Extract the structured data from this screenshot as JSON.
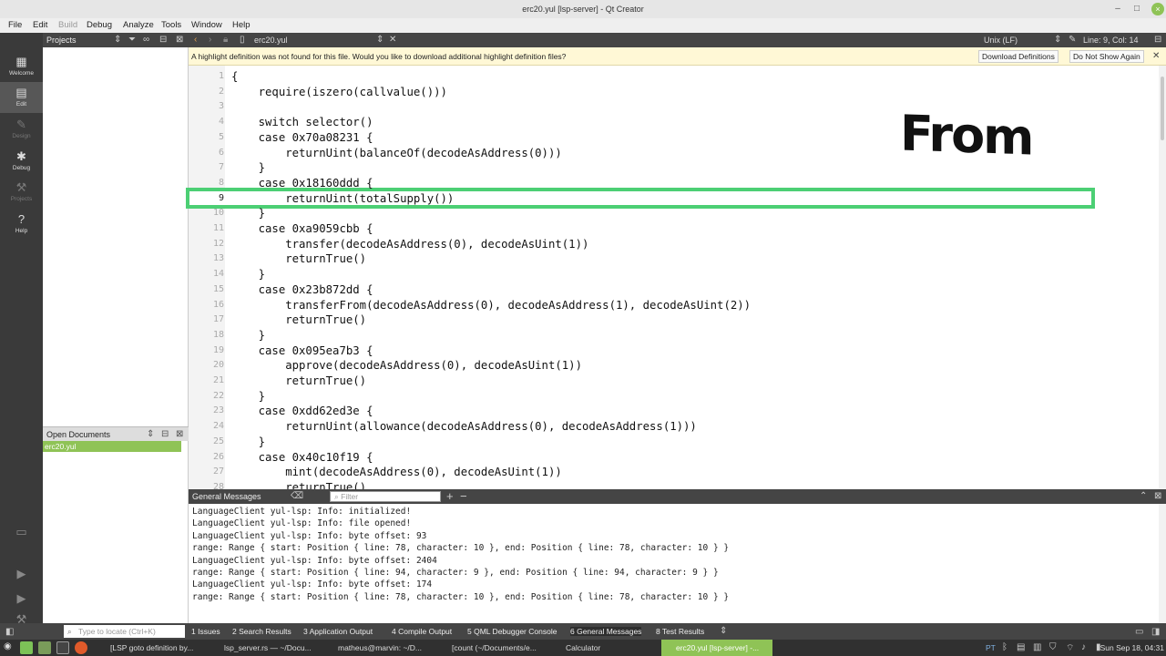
{
  "window": {
    "title": "erc20.yul [lsp-server] - Qt Creator"
  },
  "menu": [
    "File",
    "Edit",
    "Build",
    "Debug",
    "Analyze",
    "Tools",
    "Window",
    "Help"
  ],
  "modes": [
    {
      "label": "Welcome",
      "icon": "grid-icon"
    },
    {
      "label": "Edit",
      "icon": "edit-icon"
    },
    {
      "label": "Design",
      "icon": "pencil-icon"
    },
    {
      "label": "Debug",
      "icon": "bug-icon"
    },
    {
      "label": "Projects",
      "icon": "wrench-icon"
    },
    {
      "label": "Help",
      "icon": "help-icon"
    }
  ],
  "projects_panel": {
    "title": "Projects"
  },
  "open_documents": {
    "title": "Open Documents",
    "items": [
      "erc20.yul"
    ]
  },
  "editor": {
    "file": "erc20.yul",
    "line_ending": "Unix (LF)",
    "position": "Line: 9, Col: 14",
    "current_line": "9",
    "infobar": {
      "text": "A highlight definition was not found for this file. Would you like to download additional highlight definition files?",
      "download_label": "Download Definitions",
      "dont_show_label": "Do Not Show Again"
    },
    "lines": [
      {
        "n": "1",
        "code": "{"
      },
      {
        "n": "2",
        "code": "    require(iszero(callvalue()))"
      },
      {
        "n": "3",
        "code": ""
      },
      {
        "n": "4",
        "code": "    switch selector()"
      },
      {
        "n": "5",
        "code": "    case 0x70a08231 {"
      },
      {
        "n": "6",
        "code": "        returnUint(balanceOf(decodeAsAddress(0)))"
      },
      {
        "n": "7",
        "code": "    }"
      },
      {
        "n": "8",
        "code": "    case 0x18160ddd {"
      },
      {
        "n": "9",
        "code": "        returnUint(totalSupply())"
      },
      {
        "n": "10",
        "code": "    }"
      },
      {
        "n": "11",
        "code": "    case 0xa9059cbb {"
      },
      {
        "n": "12",
        "code": "        transfer(decodeAsAddress(0), decodeAsUint(1))"
      },
      {
        "n": "13",
        "code": "        returnTrue()"
      },
      {
        "n": "14",
        "code": "    }"
      },
      {
        "n": "15",
        "code": "    case 0x23b872dd {"
      },
      {
        "n": "16",
        "code": "        transferFrom(decodeAsAddress(0), decodeAsAddress(1), decodeAsUint(2))"
      },
      {
        "n": "17",
        "code": "        returnTrue()"
      },
      {
        "n": "18",
        "code": "    }"
      },
      {
        "n": "19",
        "code": "    case 0x095ea7b3 {"
      },
      {
        "n": "20",
        "code": "        approve(decodeAsAddress(0), decodeAsUint(1))"
      },
      {
        "n": "21",
        "code": "        returnTrue()"
      },
      {
        "n": "22",
        "code": "    }"
      },
      {
        "n": "23",
        "code": "    case 0xdd62ed3e {"
      },
      {
        "n": "24",
        "code": "        returnUint(allowance(decodeAsAddress(0), decodeAsAddress(1)))"
      },
      {
        "n": "25",
        "code": "    }"
      },
      {
        "n": "26",
        "code": "    case 0x40c10f19 {"
      },
      {
        "n": "27",
        "code": "        mint(decodeAsAddress(0), decodeAsUint(1))"
      },
      {
        "n": "28",
        "code": "        returnTrue()"
      }
    ],
    "overlay_text": "From"
  },
  "output": {
    "title": "General Messages",
    "filter_placeholder": "Filter",
    "lines": [
      "LanguageClient yul-lsp: Info: initialized!",
      "LanguageClient yul-lsp: Info: file opened!",
      "LanguageClient yul-lsp: Info: byte offset: 93",
      "range: Range { start: Position { line: 78, character: 10 }, end: Position { line: 78, character: 10 } }",
      "LanguageClient yul-lsp: Info: byte offset: 2404",
      "range: Range { start: Position { line: 94, character: 9 }, end: Position { line: 94, character: 9 } }",
      "LanguageClient yul-lsp: Info: byte offset: 174",
      "range: Range { start: Position { line: 78, character: 10 }, end: Position { line: 78, character: 10 } }"
    ]
  },
  "status": {
    "locate_placeholder": "Type to locate (Ctrl+K)",
    "tabs": [
      "1 Issues",
      "2 Search Results",
      "3 Application Output",
      "4 Compile Output",
      "5 QML Debugger Console",
      "6 General Messages",
      "8 Test Results"
    ]
  },
  "taskbar": {
    "items": [
      "[LSP goto definition by...",
      "lsp_server.rs — ~/Docu...",
      "matheus@marvin: ~/D...",
      "[count (~/Documents/e...",
      "Calculator",
      "erc20.yul [lsp-server] -..."
    ],
    "lang": "PT",
    "clock": "Sun Sep 18, 04:31"
  },
  "colors": {
    "accent": "#8fc356",
    "highlight_box": "#4ccf74",
    "infobar_bg": "#fff8d6"
  }
}
